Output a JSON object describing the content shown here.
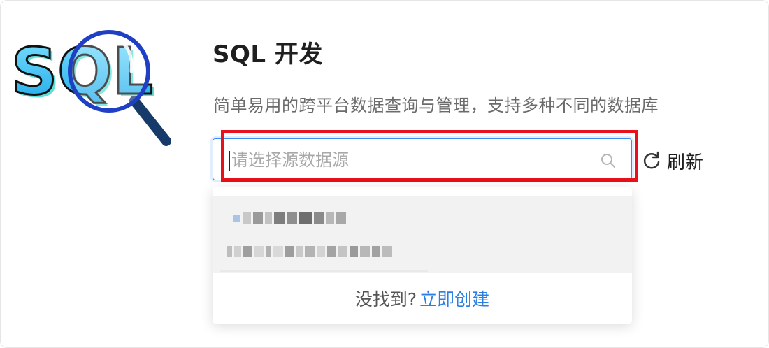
{
  "logo": {
    "text": "SQL"
  },
  "page_title": "SQL 开发",
  "subtitle": "简单易用的跨平台数据查询与管理，支持多种不同的数据库",
  "datasource_select": {
    "placeholder": "请选择源数据源",
    "value": ""
  },
  "refresh_label": "刷新",
  "dropdown": {
    "footer_text": "没找到?",
    "create_link": "立即创建"
  },
  "colors": {
    "accent": "#3f8cf3",
    "link": "#2b7fe0",
    "highlight_box": "#e8101a",
    "option_hover_bg": "#f2f2f2"
  },
  "icons": {
    "logo": "sql-magnifier-logo",
    "search": "search-icon",
    "refresh": "refresh-icon"
  }
}
